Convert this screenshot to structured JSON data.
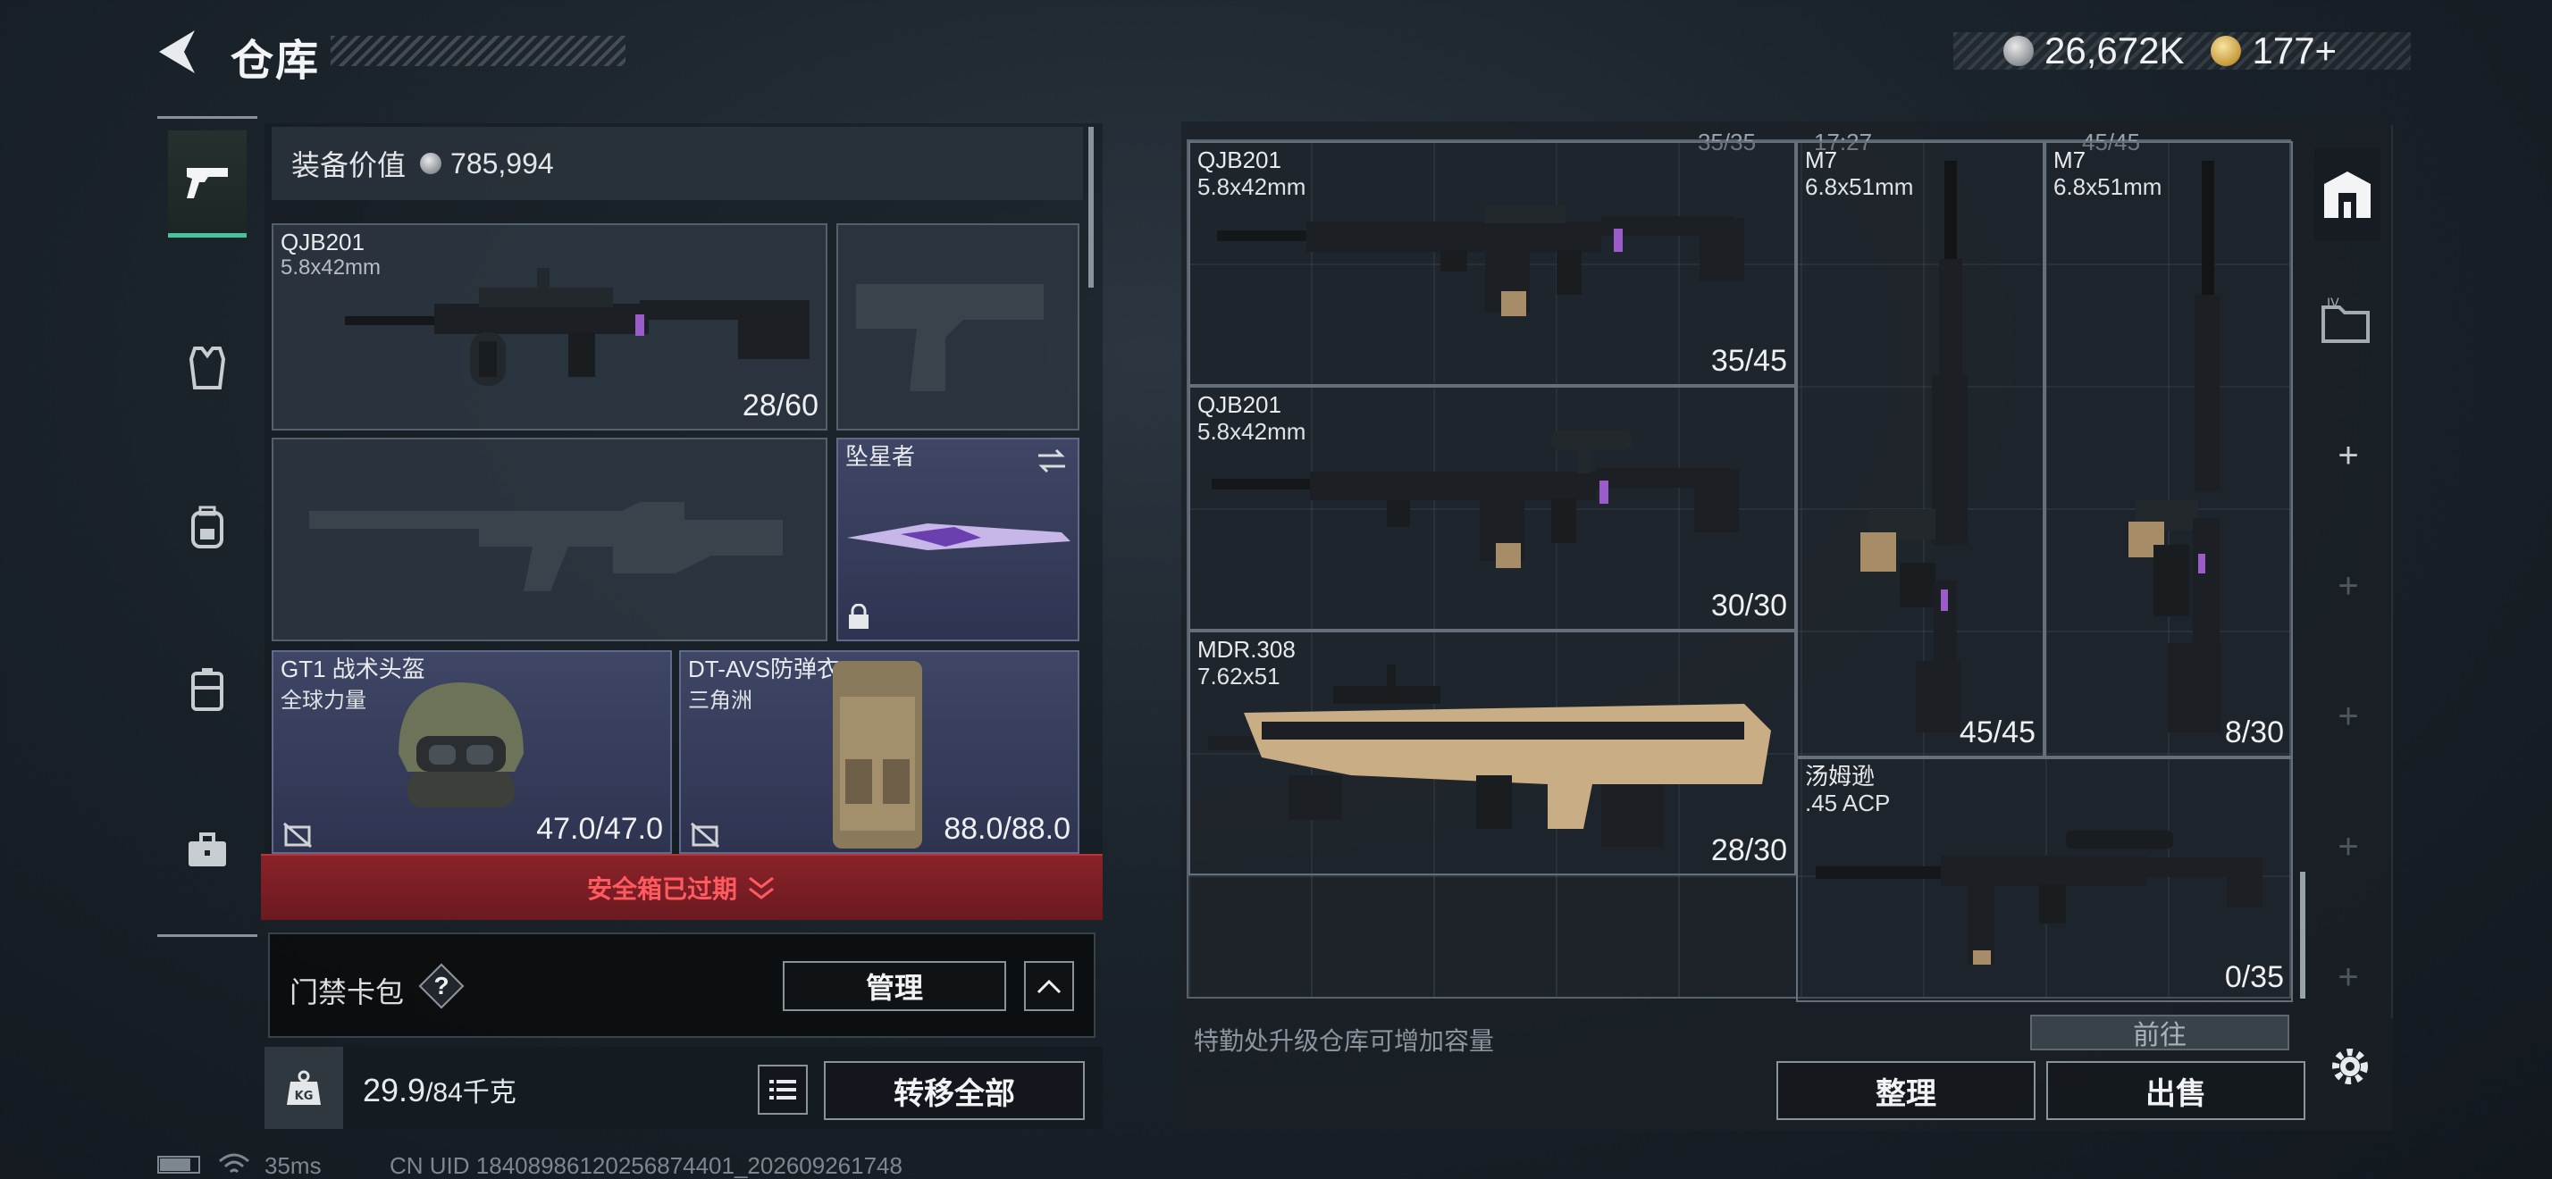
{
  "header": {
    "title": "仓库",
    "currency": [
      {
        "icon": "silver-coin-icon",
        "value": "26,672K"
      },
      {
        "icon": "gold-coin-icon",
        "value": "177+"
      }
    ]
  },
  "equipment": {
    "value_label": "装备价值",
    "value": "785,994",
    "primary_weapon": {
      "name": "QJB201",
      "caliber": "5.8x42mm",
      "ammo": "28/60"
    },
    "melee": {
      "name": "坠星者"
    },
    "helmet": {
      "name": "GT1 战术头盔",
      "maker": "全球力量",
      "durability": "47.0/47.0"
    },
    "armor": {
      "name": "DT-AVS防弹衣",
      "maker": "三角洲",
      "durability": "88.0/88.0"
    },
    "safe_box_notice": "安全箱已过期",
    "keycard": {
      "label": "门禁卡包",
      "help": "?",
      "manage": "管理"
    },
    "weight": {
      "current": "29.9",
      "max": "/84千克"
    },
    "transfer_all": "转移全部"
  },
  "storage": {
    "top_partial": [
      "35/35",
      "17:27",
      "45/45"
    ],
    "items": [
      {
        "name": "QJB201",
        "caliber": "5.8x42mm",
        "ammo": "35/45"
      },
      {
        "name": "M7",
        "caliber": "6.8x51mm",
        "ammo": "45/45"
      },
      {
        "name": "M7",
        "caliber": "6.8x51mm",
        "ammo": "8/30"
      },
      {
        "name": "QJB201",
        "caliber": "5.8x42mm",
        "ammo": "30/30"
      },
      {
        "name": "MDR.308",
        "caliber": "7.62x51",
        "ammo": "28/30"
      },
      {
        "name": "汤姆逊",
        "caliber": ".45 ACP",
        "ammo": "0/35"
      }
    ],
    "upgrade_hint": "特勤处升级仓库可增加容量",
    "goto": "前往",
    "sort": "整理",
    "sell": "出售"
  },
  "status_bar": {
    "ping": "35ms",
    "uid": "CN UID 18408986120256874401_202609261748"
  },
  "colors": {
    "accent_green": "#46c39a",
    "alert_red": "#ff5a5f",
    "alert_bg": "#7a1e24"
  }
}
